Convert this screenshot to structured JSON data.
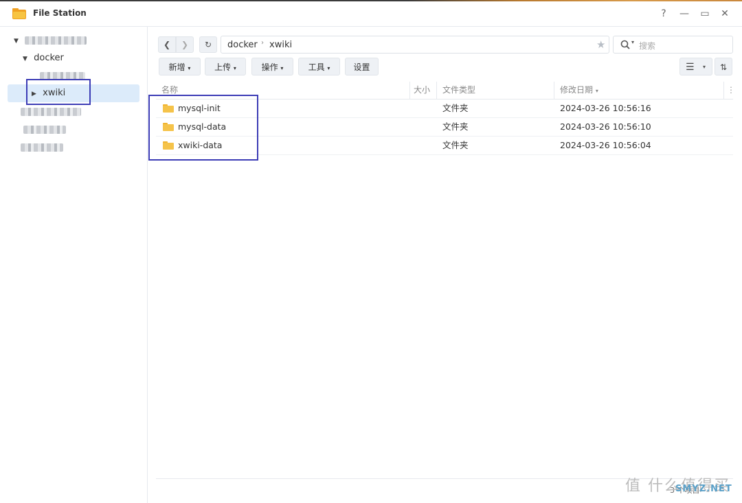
{
  "window": {
    "title": "File Station",
    "controls": [
      "?",
      "—",
      "▭",
      "✕"
    ]
  },
  "sidebar": {
    "items": [
      {
        "label": "docker",
        "expanded": true
      },
      {
        "label": "xwiki",
        "selected": true
      }
    ]
  },
  "toolbar": {
    "path": [
      "docker",
      "xwiki"
    ],
    "search_placeholder": "搜索",
    "buttons": [
      "新增",
      "上传",
      "操作",
      "工具",
      "设置"
    ]
  },
  "table": {
    "columns": [
      "名称",
      "大小",
      "文件类型",
      "修改日期"
    ],
    "rows": [
      {
        "name": "mysql-init",
        "size": "",
        "type": "文件夹",
        "modified": "2024-03-26 10:56:16"
      },
      {
        "name": "mysql-data",
        "size": "",
        "type": "文件夹",
        "modified": "2024-03-26 10:56:10"
      },
      {
        "name": "xwiki-data",
        "size": "",
        "type": "文件夹",
        "modified": "2024-03-26 10:56:04"
      }
    ]
  },
  "status": {
    "count_text": "3 个项目"
  },
  "watermark": {
    "text": "值 什么值得买",
    "net": "SMYZ.NET"
  },
  "colors": {
    "accent": "#3b3bb5",
    "folder": "#f5c34a",
    "selection": "#dcebfa"
  },
  "icons": [
    "folder-icon",
    "back-icon",
    "forward-icon",
    "refresh-icon",
    "star-icon",
    "search-icon",
    "list-view-icon",
    "sort-icon"
  ]
}
